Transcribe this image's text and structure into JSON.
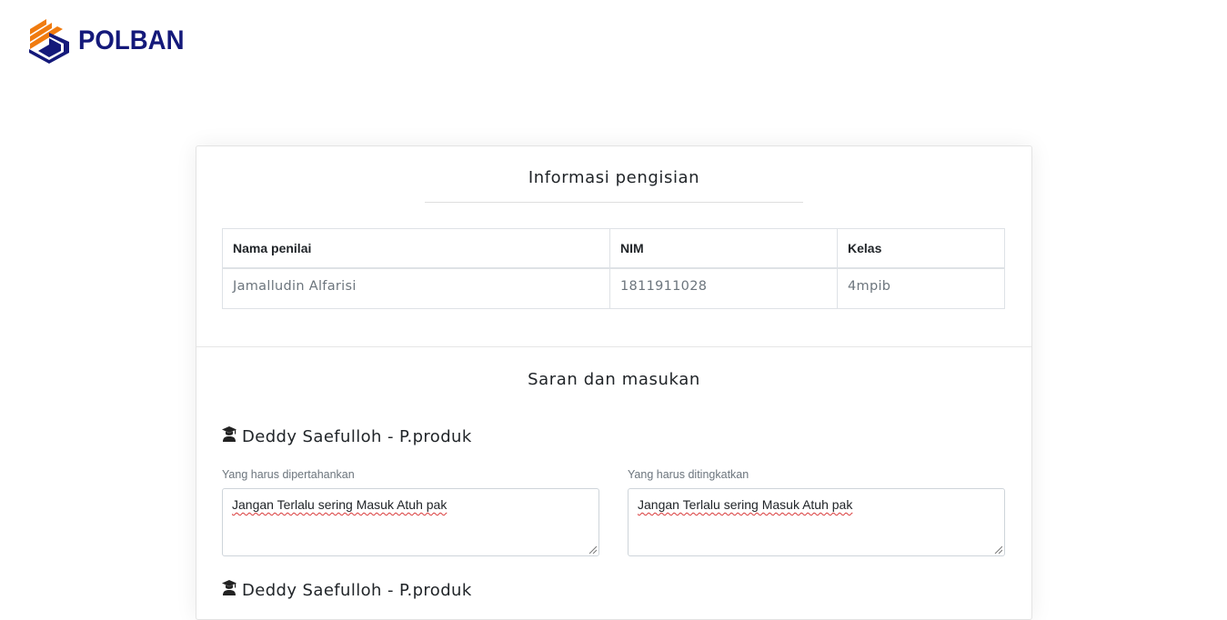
{
  "brand": {
    "name": "POLBAN",
    "color": "#14197a",
    "accent": "#f07b0f"
  },
  "info_section": {
    "title": "Informasi pengisian",
    "table": {
      "headers": [
        "Nama penilai",
        "NIM",
        "Kelas"
      ],
      "row": [
        "Jamalludin Alfarisi",
        "1811911028",
        "4mpib"
      ]
    }
  },
  "feedback_section": {
    "title": "Saran dan masukan",
    "entries": [
      {
        "icon": "graduate-icon",
        "lecturer": "Deddy Saefulloh - P.produk",
        "keep_label": "Yang harus dipertahankan",
        "keep_value": "Jangan Terlalu sering Masuk Atuh pak",
        "improve_label": "Yang harus ditingkatkan",
        "improve_value": "Jangan Terlalu sering Masuk Atuh pak"
      },
      {
        "icon": "graduate-icon",
        "lecturer": "Deddy Saefulloh - P.produk"
      }
    ]
  }
}
